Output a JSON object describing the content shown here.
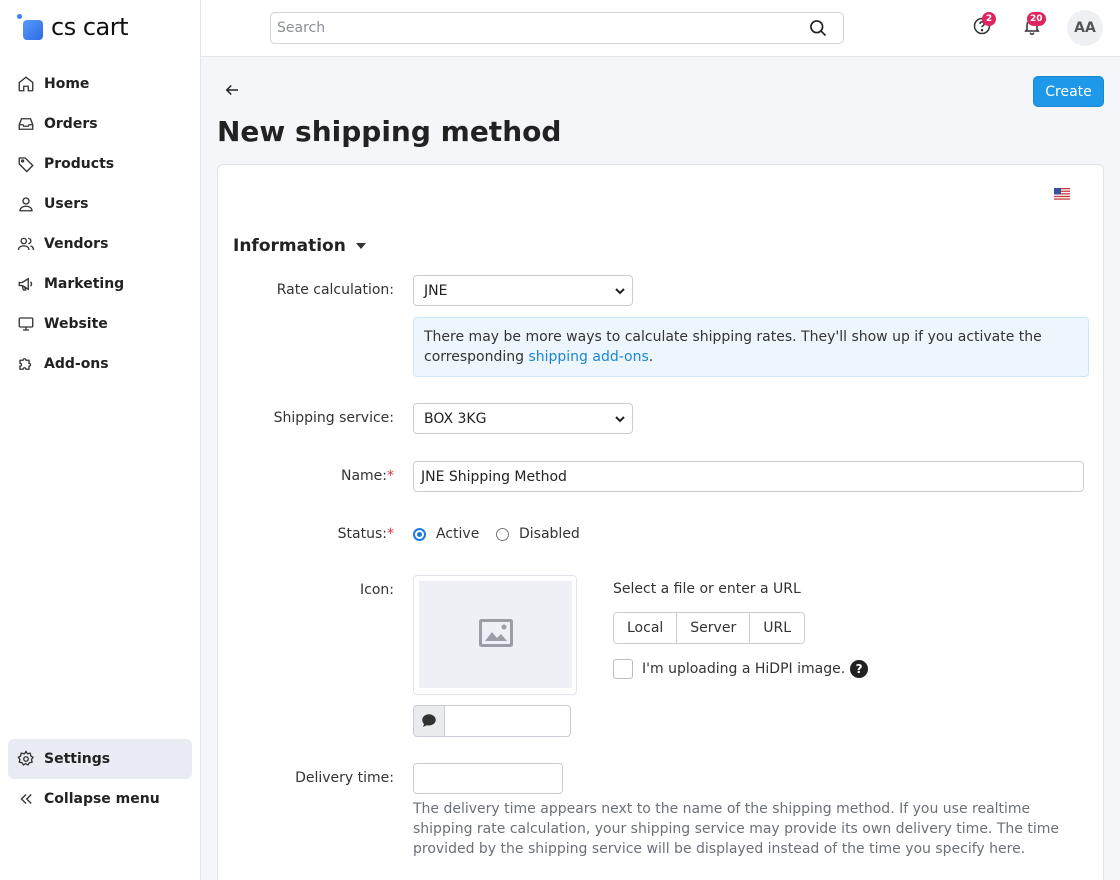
{
  "app": {
    "logo_text": "cs cart"
  },
  "sidebar": {
    "items": [
      {
        "label": "Home",
        "icon": "home-icon"
      },
      {
        "label": "Orders",
        "icon": "inbox-icon"
      },
      {
        "label": "Products",
        "icon": "tag-icon"
      },
      {
        "label": "Users",
        "icon": "user-icon"
      },
      {
        "label": "Vendors",
        "icon": "users-icon"
      },
      {
        "label": "Marketing",
        "icon": "megaphone-icon"
      },
      {
        "label": "Website",
        "icon": "monitor-icon"
      },
      {
        "label": "Add-ons",
        "icon": "puzzle-icon"
      }
    ],
    "settings_label": "Settings",
    "collapse_label": "Collapse menu"
  },
  "header": {
    "search_placeholder": "Search",
    "help_badge": "2",
    "notifications_badge": "20",
    "avatar_initials": "AA"
  },
  "page": {
    "title": "New shipping method",
    "create_label": "Create"
  },
  "form": {
    "section_title": "Information",
    "rate_calc_label": "Rate calculation:",
    "rate_calc_value": "JNE",
    "info_text": "There may be more ways to calculate shipping rates. They'll show up if you activate the corresponding ",
    "info_link": "shipping add-ons",
    "info_end": ".",
    "service_label": "Shipping service:",
    "service_value": "BOX 3KG",
    "name_label": "Name:",
    "name_value": "JNE Shipping Method",
    "status_label": "Status:",
    "status_active": "Active",
    "status_disabled": "Disabled",
    "icon_label": "Icon:",
    "upload_title": "Select a file or enter a URL",
    "upload_buttons": [
      "Local",
      "Server",
      "URL"
    ],
    "hidpi_label": "I'm uploading a HiDPI image.",
    "help_glyph": "?",
    "delivery_label": "Delivery time:",
    "delivery_hint": "The delivery time appears next to the name of the shipping method. If you use realtime shipping rate calculation, your shipping service may provide its own delivery time. The time provided by the shipping service will be displayed instead of the time you specify here."
  },
  "colors": {
    "accent": "#1e98e8",
    "link": "#1a86d0",
    "required": "#d9363e",
    "badge": "#e0245e"
  }
}
